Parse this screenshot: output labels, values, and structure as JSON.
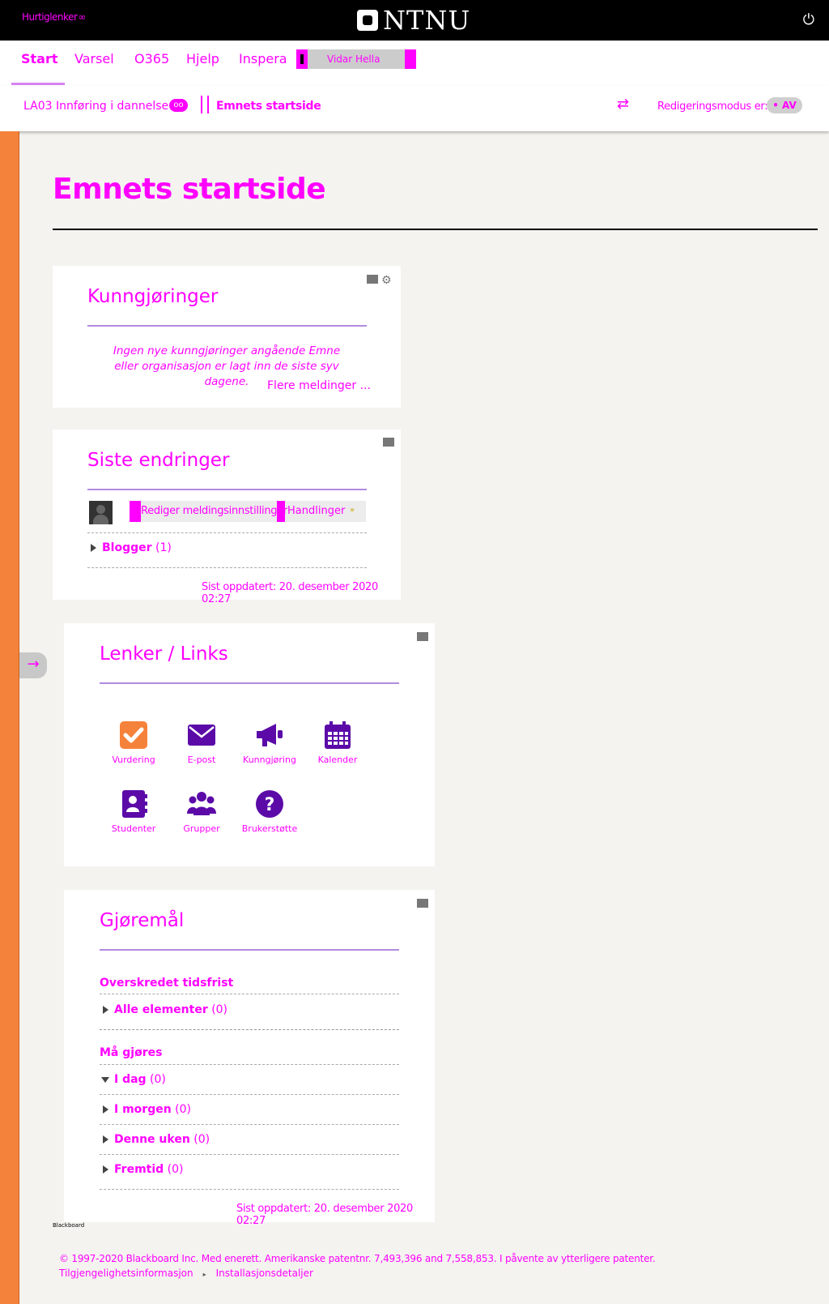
{
  "topbar": {
    "quicklinks_label": "Hurtiglenker",
    "logo_text": "NTNU",
    "power_icon": "power-icon"
  },
  "nav": {
    "tabs": [
      "Start",
      "Varsel",
      "O365",
      "Hjelp",
      "Inspera"
    ],
    "active_tab": "Start",
    "user_name": "Vidar Hella"
  },
  "breadcrumb": {
    "course": "LA03 Innføring i dannelse",
    "page": "Emnets startside",
    "edit_mode_label": "Redigeringsmodus er:",
    "edit_mode_value": "AV"
  },
  "page": {
    "title": "Emnets startside"
  },
  "announcements": {
    "title": "Kunngjøringer",
    "message": "Ingen nye kunngjøringer angående Emne eller organisasjon er lagt inn de siste syv dagene.",
    "more_link": "Flere meldinger ..."
  },
  "recent_changes": {
    "title": "Siste endringer",
    "edit_notifications": "Rediger meldingsinnstillinger",
    "actions": "Handlinger",
    "blogs_label": "Blogger",
    "blogs_count": "(1)",
    "updated": "Sist oppdatert: 20. desember 2020 02:27"
  },
  "links": {
    "title": "Lenker / Links",
    "items": [
      {
        "label": "Vurdering",
        "icon": "checkbox-icon",
        "color": "#f5823a"
      },
      {
        "label": "E-post",
        "icon": "envelope-icon",
        "color": "#5b0aa8"
      },
      {
        "label": "Kunngjøring",
        "icon": "megaphone-icon",
        "color": "#5b0aa8"
      },
      {
        "label": "Kalender",
        "icon": "calendar-icon",
        "color": "#5b0aa8"
      },
      {
        "label": "Studenter",
        "icon": "address-book-icon",
        "color": "#5b0aa8"
      },
      {
        "label": "Grupper",
        "icon": "users-icon",
        "color": "#5b0aa8"
      },
      {
        "label": "Brukerstøtte",
        "icon": "question-icon",
        "color": "#5b0aa8"
      }
    ]
  },
  "todo": {
    "title": "Gjøremål",
    "overdue_heading": "Overskredet tidsfrist",
    "overdue_all_label": "Alle elementer",
    "overdue_all_count": "(0)",
    "due_heading": "Må gjøres",
    "due_items": [
      {
        "label": "I dag",
        "count": "(0)"
      },
      {
        "label": "I morgen",
        "count": "(0)"
      },
      {
        "label": "Denne uken",
        "count": "(0)"
      },
      {
        "label": "Fremtid",
        "count": "(0)"
      }
    ],
    "updated": "Sist oppdatert: 20. desember 2020 02:27"
  },
  "footer": {
    "brand": "Blackboard",
    "copyright": "© 1997-2020 Blackboard Inc. Med enerett. Amerikanske patentnr. 7,493,396 and 7,558,853. I påvente av ytterligere patenter.",
    "accessibility": "Tilgjengelighetsinformasjon",
    "installation": "Installasjonsdetaljer"
  },
  "colors": {
    "accent": "#ff00ff",
    "sidebar": "#f5823a",
    "icon_purple": "#5b0aa8",
    "rule": "#b18ae0"
  }
}
